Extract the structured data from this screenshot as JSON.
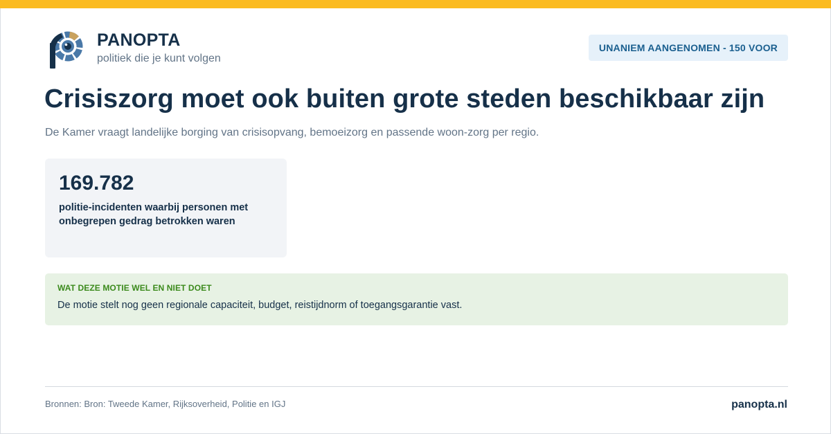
{
  "brand": {
    "name": "PANOPTA",
    "tagline": "politiek die je kunt volgen",
    "logo_icon": "panopta-eye-logo-icon"
  },
  "vote_badge": "UNANIEM AANGENOMEN - 150 VOOR",
  "title": "Crisiszorg moet ook buiten grote steden beschikbaar zijn",
  "subtitle": "De Kamer vraagt landelijke borging van crisisopvang, bemoeizorg en passende woon-zorg per regio.",
  "stat": {
    "value": "169.782",
    "label": "politie-incidenten waarbij personen met onbegrepen gedrag betrokken waren"
  },
  "notice": {
    "heading": "WAT DEZE MOTIE WEL EN NIET DOET",
    "text": "De motie stelt nog geen regionale capaciteit, budget, reistijdnorm of toegangsgarantie vast."
  },
  "footer": {
    "sources": "Bronnen: Bron: Tweede Kamer, Rijksoverheid, Politie en IGJ",
    "site": "panopta.nl"
  },
  "colors": {
    "accent_bar": "#fbbb21",
    "navy": "#163049",
    "badge_bg": "#e6f1fa",
    "badge_text": "#1a5f8f",
    "notice_bg": "#e7f2e4",
    "notice_heading": "#3b8a1c",
    "card_bg": "#f2f4f7"
  }
}
